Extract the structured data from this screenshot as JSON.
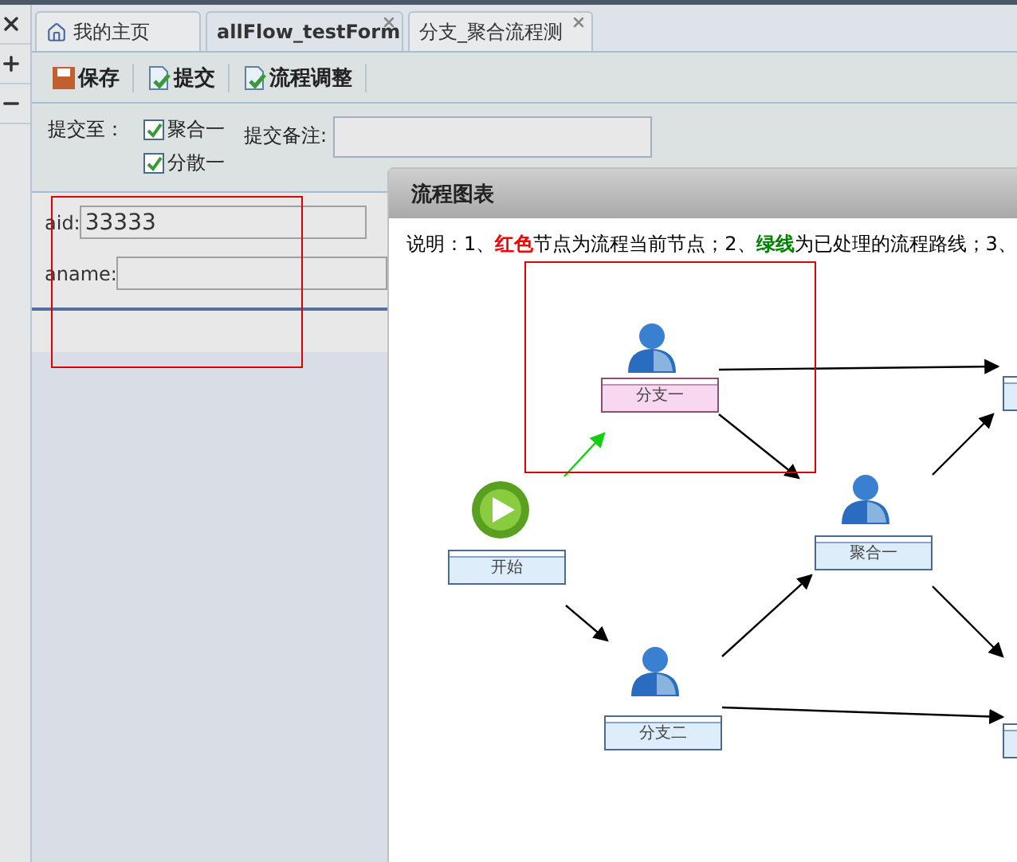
{
  "tabs": [
    {
      "label": "我的主页",
      "selected": false,
      "closable": false,
      "kind": "home"
    },
    {
      "label": "allFlow_testForm",
      "selected": true,
      "closable": true,
      "kind": "form"
    },
    {
      "label": "分支_聚合流程测",
      "selected": false,
      "closable": true,
      "kind": "form"
    }
  ],
  "toolbar": [
    {
      "label": "保存",
      "kind": "save"
    },
    {
      "label": "提交",
      "kind": "submit"
    },
    {
      "label": "流程调整",
      "kind": "adjust"
    }
  ],
  "submit_to": {
    "label": "提交至：",
    "options": [
      {
        "label": "聚合一",
        "checked": true
      },
      {
        "label": "分散一",
        "checked": true
      }
    ]
  },
  "remark": {
    "label": "提交备注:"
  },
  "form": {
    "fields": [
      {
        "label": "aid:",
        "value": "33333"
      },
      {
        "label": "aname:"
      }
    ]
  },
  "dialog": {
    "title": "流程图表",
    "note": [
      {
        "text": "说明：1、"
      },
      {
        "text": "红色",
        "color": "#ff0000"
      },
      {
        "text": "节点为流程当前节点；2、"
      },
      {
        "text": "绿线",
        "color": "#008000"
      },
      {
        "text": "为已处理的流程路线；3、"
      }
    ],
    "nodes": [
      {
        "label": "分支一",
        "kind": "task",
        "current": true
      },
      {
        "label": "开始",
        "kind": "start",
        "current": false
      },
      {
        "label": "聚合一",
        "kind": "task",
        "current": false
      },
      {
        "label": "分支二",
        "kind": "task",
        "current": false
      },
      {
        "kind": "partial",
        "current": false
      },
      {
        "kind": "partial",
        "current": false
      }
    ],
    "edges": [
      {
        "done": true
      },
      {
        "done": false
      },
      {
        "done": false
      },
      {
        "done": false
      },
      {
        "done": false
      },
      {
        "done": false
      },
      {
        "done": false
      },
      {
        "done": false
      }
    ]
  }
}
